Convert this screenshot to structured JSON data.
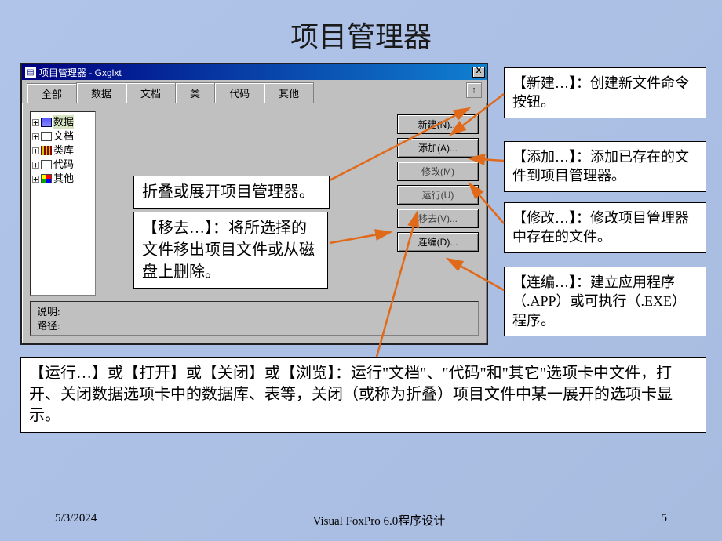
{
  "slide": {
    "title": "项目管理器",
    "footer_date": "5/3/2024",
    "footer_center": "Visual FoxPro 6.0程序设计",
    "footer_page": "5"
  },
  "window": {
    "title": "项目管理器 - Gxglxt",
    "close": "X",
    "collapse_hint": "↑",
    "tabs": [
      "全部",
      "数据",
      "文档",
      "类",
      "代码",
      "其他"
    ],
    "tree": [
      {
        "label": "数据",
        "icon": "data",
        "selected": true
      },
      {
        "label": "文档",
        "icon": "doc"
      },
      {
        "label": "类库",
        "icon": "lib"
      },
      {
        "label": "代码",
        "icon": "code"
      },
      {
        "label": "其他",
        "icon": "other"
      }
    ],
    "buttons": {
      "new": "新建(N)...",
      "add": "添加(A)...",
      "modify": "修改(M)",
      "run": "运行(U)",
      "remove": "移去(V)...",
      "build": "连编(D)..."
    },
    "status_desc_label": "说明:",
    "status_path_label": "路径:"
  },
  "annotations": {
    "callout_collapse": "折叠或展开项目管理器。",
    "callout_remove": "【移去…】：将所选择的文件移出项目文件或从磁盘上删除。",
    "callout_new": "【新建…】：创建新文件命令按钮。",
    "callout_add": "【添加…】：添加已存在的文件到项目管理器。",
    "callout_modify": "【修改…】：修改项目管理器中存在的文件。",
    "callout_build": "【连编…】：建立应用程序（.APP）或可执行（.EXE）程序。",
    "callout_run": "【运行…】或【打开】或【关闭】或【浏览】：运行\"文档\"、\"代码\"和\"其它\"选项卡中文件，打开、关闭数据选项卡中的数据库、表等，关闭（或称为折叠）项目文件中某一展开的选项卡显示。"
  }
}
